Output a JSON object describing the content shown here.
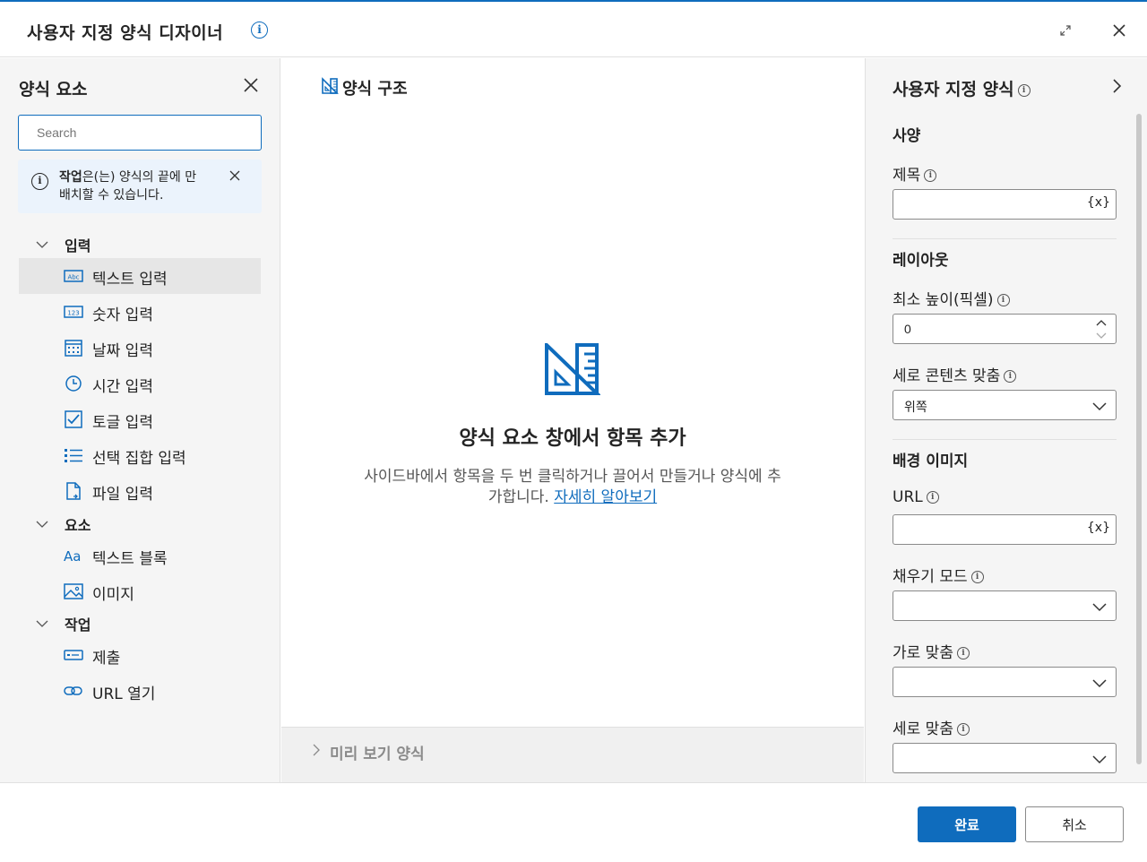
{
  "window": {
    "title": "사용자 지정 양식 디자이너",
    "info_icon": "info-icon",
    "accent": "#0f6cbd"
  },
  "left_pane": {
    "title": "양식 요소",
    "search_placeholder": "Search",
    "notice": {
      "bold": "작업",
      "text": "은(는) 양식의 끝에 만 배치할 수 있습니다."
    },
    "sections": [
      {
        "label": "입력",
        "items": [
          {
            "label": "텍스트 입력",
            "icon": "text-input-icon",
            "selected": true
          },
          {
            "label": "숫자 입력",
            "icon": "number-input-icon"
          },
          {
            "label": "날짜 입력",
            "icon": "calendar-icon"
          },
          {
            "label": "시간 입력",
            "icon": "clock-icon"
          },
          {
            "label": "토글 입력",
            "icon": "checkbox-icon"
          },
          {
            "label": "선택 집합 입력",
            "icon": "list-icon"
          },
          {
            "label": "파일 입력",
            "icon": "file-icon"
          }
        ]
      },
      {
        "label": "요소",
        "items": [
          {
            "label": "텍스트 블록",
            "icon": "text-block-icon"
          },
          {
            "label": "이미지",
            "icon": "image-icon"
          }
        ]
      },
      {
        "label": "작업",
        "items": [
          {
            "label": "제출",
            "icon": "submit-icon"
          },
          {
            "label": "URL 열기",
            "icon": "link-icon"
          }
        ]
      }
    ]
  },
  "center": {
    "title": "양식 구조",
    "empty_title": "양식 요소 창에서 항목 추가",
    "empty_desc": "사이드바에서 항목을 두 번 클릭하거나 끌어서 만들거나 양식에 추가합니다.",
    "learn_more": "자세히 알아보기",
    "preview_label": "미리 보기 양식"
  },
  "right_pane": {
    "title": "사용자 지정 양식",
    "spec_head": "사양",
    "title_label": "제목",
    "title_value": "",
    "fx": "{x}",
    "layout_head": "레이아웃",
    "min_height_label": "최소 높이(픽셀)",
    "min_height_value": "0",
    "vertical_content_label": "세로 콘텐츠 맞춤",
    "vertical_content_value": "위쪽",
    "bg_head": "배경 이미지",
    "url_label": "URL",
    "url_value": "",
    "fill_mode_label": "채우기 모드",
    "fill_mode_value": "",
    "horizontal_label": "가로 맞춤",
    "horizontal_value": "",
    "vertical_label": "세로 맞춤",
    "vertical_value": ""
  },
  "footer": {
    "done": "완료",
    "cancel": "취소"
  }
}
